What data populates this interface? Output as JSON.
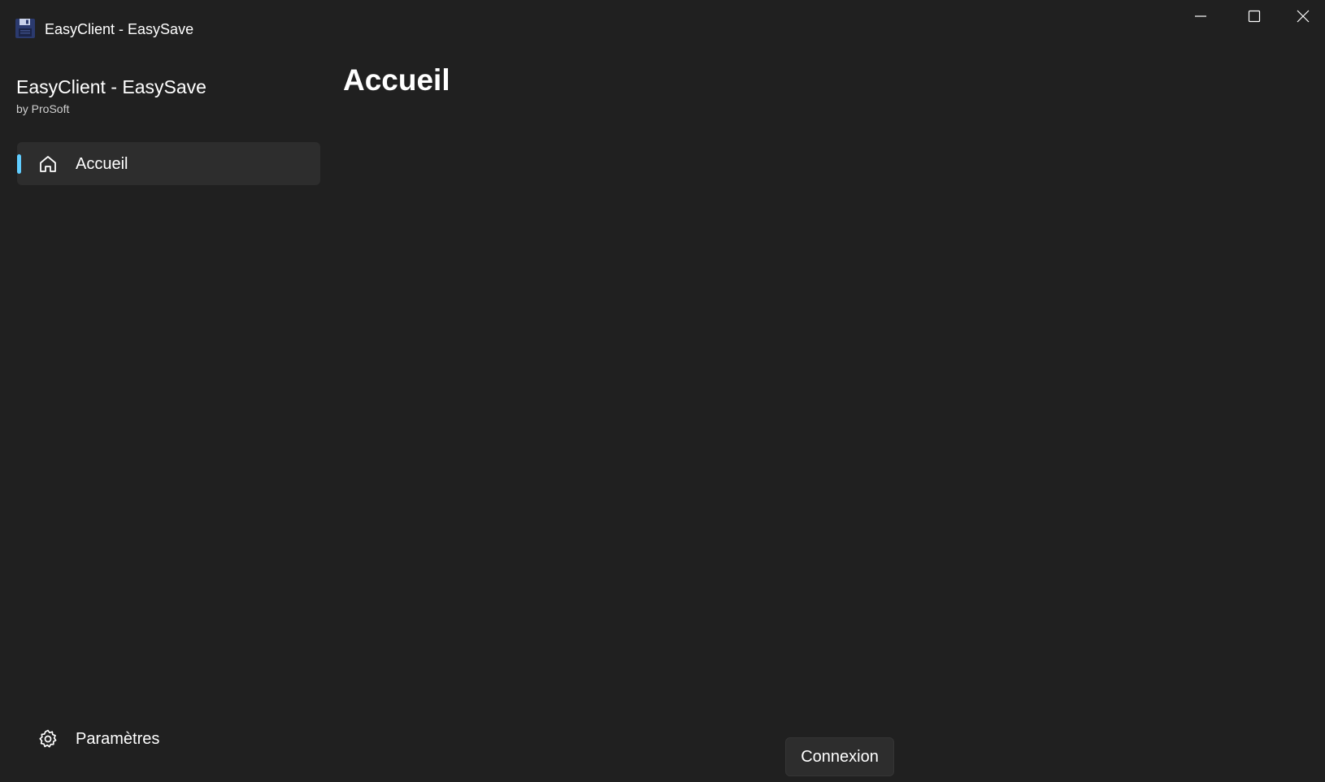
{
  "window": {
    "title": "EasyClient - EasySave",
    "icon": "floppy-disk-icon",
    "controls": [
      "minimize-icon",
      "maximize-icon",
      "close-icon"
    ]
  },
  "sidebar": {
    "app_name": "EasyClient - EasySave",
    "app_subtitle": "by ProSoft",
    "items": [
      {
        "label": "Accueil",
        "icon": "home-icon",
        "selected": true
      }
    ],
    "footer": {
      "label": "Paramètres",
      "icon": "gear-icon"
    }
  },
  "main": {
    "title": "Accueil",
    "connect_label": "Connexion"
  },
  "colors": {
    "background": "#202020",
    "nav_selected": "#2d2d2d",
    "accent": "#60cdff",
    "text": "#ffffff"
  }
}
